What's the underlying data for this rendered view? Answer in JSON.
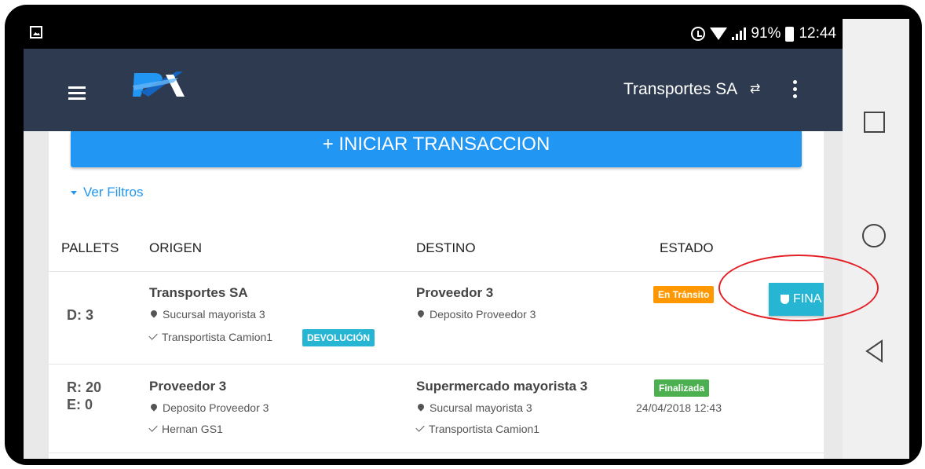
{
  "status_bar": {
    "battery_percent": "91%",
    "time": "12:44",
    "icons": [
      "gallery-icon",
      "alarm-icon",
      "wifi-icon",
      "signal-icon",
      "battery-icon"
    ]
  },
  "app_bar": {
    "company": "Transportes SA",
    "switch_icon": "swap-arrows-icon",
    "menu_icon": "hamburger-icon",
    "overflow_icon": "kebab-icon",
    "logo_icon": "px-logo-icon",
    "color": "#2e3a4f"
  },
  "actions": {
    "start_button": "+ INICIAR TRANSACCION",
    "filters_link": "Ver Filtros",
    "accent_color": "#2196f3"
  },
  "table": {
    "headers": [
      "PALLETS",
      "ORIGEN",
      "DESTINO",
      "ESTADO"
    ],
    "rows": [
      {
        "pallets": [
          "D: 3"
        ],
        "origin_name": "Transportes SA",
        "origin_location": "Sucursal mayorista 3",
        "origin_carrier": "Transportista Camion1",
        "origin_badge": "DEVOLUCIÓN",
        "dest_name": "Proveedor 3",
        "dest_location": "Deposito Proveedor 3",
        "status": "En Tránsito",
        "action_label": "FINA"
      },
      {
        "pallets": [
          "R: 20",
          "E: 0"
        ],
        "origin_name": "Proveedor 3",
        "origin_location": "Deposito Proveedor 3",
        "origin_carrier": "Hernan GS1",
        "dest_name": "Supermercado mayorista 3",
        "dest_location": "Sucursal mayorista 3",
        "dest_carrier": "Transportista Camion1",
        "status": "Finalizada",
        "datetime": "24/04/2018 12:43"
      }
    ]
  },
  "colors": {
    "in_transit": "#ff9800",
    "finalized": "#4caf50",
    "badge_cyan": "#26b6d4",
    "annotation": "#e31e24"
  }
}
